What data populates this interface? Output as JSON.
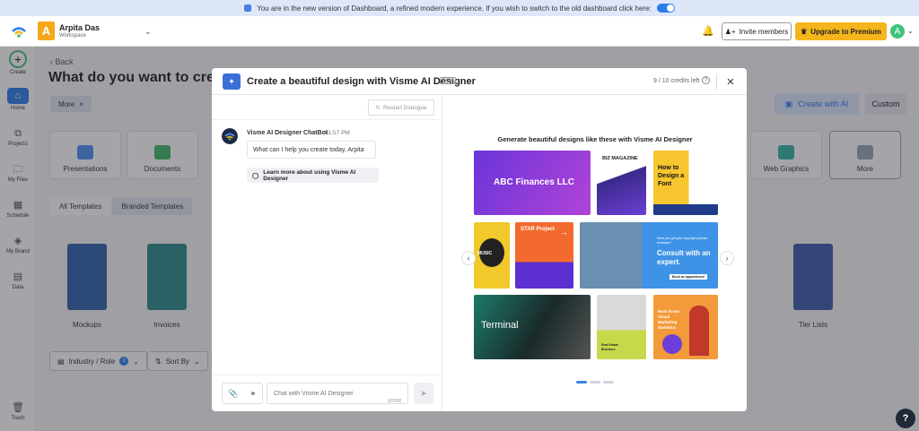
{
  "banner": {
    "text": "You are in the new version of Dashboard, a refined modern experience. If you wish to switch to the old dashboard click here:"
  },
  "topbar": {
    "workspace_initial": "A",
    "workspace_name": "Arpita Das",
    "workspace_sub": "Workspace",
    "invite_label": "Invite members",
    "upgrade_label": "Upgrade to Premium",
    "user_initial": "A"
  },
  "sidebar": {
    "items": [
      {
        "label": "Create"
      },
      {
        "label": "Home"
      },
      {
        "label": "Projects"
      },
      {
        "label": "My Files"
      },
      {
        "label": "Schedule"
      },
      {
        "label": "My Brand"
      },
      {
        "label": "Data"
      },
      {
        "label": "Trash"
      }
    ]
  },
  "background": {
    "back_label": "Back",
    "title": "What do you want to create",
    "more_pill": "More",
    "create_ai_label": "Create with AI",
    "custom_label": "Custom",
    "categories": [
      {
        "label": "Presentations",
        "color": "#4f8ff0"
      },
      {
        "label": "Documents",
        "color": "#3fb86a"
      },
      {
        "label": "Web Graphics",
        "color": "#35b3a5"
      },
      {
        "label": "More",
        "color": "#9aa3b5"
      }
    ],
    "template_tabs": [
      "All Templates",
      "Branded Templates"
    ],
    "templates": [
      {
        "label": "Mockups"
      },
      {
        "label": "Invoices"
      },
      {
        "label": "Tier Lists"
      }
    ],
    "filters": {
      "industry_label": "Industry / Role",
      "industry_count": "2",
      "sort_label": "Sort By"
    }
  },
  "modal": {
    "title": "Create a beautiful design with Visme AI Designer",
    "beta": "Beta",
    "credits": "9 / 10 credits left",
    "restart_label": "Restart Dialogue",
    "bot_name": "Visme AI Designer ChatBot",
    "bot_time": "01:57 PM",
    "bot_message": "What can I help you create today, Arpita",
    "learn_label": "Learn more about using Visme AI Designer",
    "input_placeholder": "Chat with Visme AI Designer",
    "char_count": "0/2500",
    "gallery_heading": "Generate beautiful designs like these with Visme AI Designer",
    "tiles": {
      "abc": "ABC Finances LLC",
      "biz": "BIZ MAGAZINE",
      "font": "How to Design a Font",
      "music": "MUSIC",
      "star": "STAR Project",
      "consult": "Consult with an expert.",
      "consult_pre": "Have you got your copyright policies reviewed?",
      "consult_btn": "Book an appointment",
      "terminal": "Terminal",
      "estate": "Real Estate Brochure",
      "stats": "Must Know Visual Marketing Statistics"
    }
  }
}
